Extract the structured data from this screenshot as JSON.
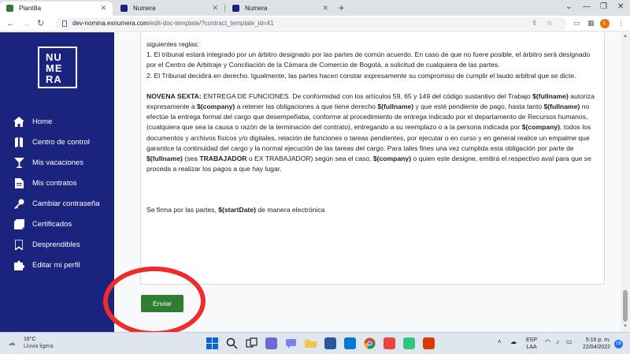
{
  "browser": {
    "tabs": [
      {
        "title": "Plantilla",
        "color": "#2e7d32"
      },
      {
        "title": "Numera",
        "color": "#1a237e"
      },
      {
        "title": "Numera",
        "color": "#1a237e"
      }
    ],
    "new_tab_symbol": "+",
    "url_host": "dev-nomina.esnumera.com",
    "url_path": "/edit-doc-template/?contract_template_id=41",
    "profile_initial": "L"
  },
  "logo": {
    "letters": [
      "NU",
      "ME",
      "RA"
    ]
  },
  "sidebar": {
    "items": [
      {
        "label": "Home",
        "icon": "home-icon"
      },
      {
        "label": "Centro de control",
        "icon": "book-icon"
      },
      {
        "label": "Mis vacaciones",
        "icon": "cocktail-icon"
      },
      {
        "label": "Mis contratos",
        "icon": "document-icon"
      },
      {
        "label": "Cambiar contraseña",
        "icon": "key-icon"
      },
      {
        "label": "Certificados",
        "icon": "certificate-icon"
      },
      {
        "label": "Desprendibles",
        "icon": "bookmark-icon"
      },
      {
        "label": "Editar mi perfil",
        "icon": "puzzle-icon"
      }
    ]
  },
  "document": {
    "p0": "siguientes reglas:",
    "p1": "1. El tribunal estará integrado por un árbitro designado por las partes de común acuerdo. En caso de que no fuere posible, el árbitro será designado por el Centro de Arbitraje y Conciliación de la Cámara de Comercio de Bogotá, a solicitud de cualquiera de las partes.",
    "p2": "2. El Tribunal decidirá en derecho. Igualmente, las partes hacen constar expresamente su compromiso de cumplir el laudo arbitral que se dicte.",
    "clause": {
      "heading": "NOVENA SEXTA:",
      "t1": " ENTREGA DE FUNCIONES",
      "t2": ". De conformidad con los artículos 59, 65 y 149 del código sustantivo del Trabajo ",
      "v_fullname": "$(fullname)",
      "v_company": "$(company)",
      "t3": " autoriza expresamente a ",
      "t4": " a retener las obligaciones a que tiene derecho ",
      "t5": " y que esté pendiente de pago, hasta tanto ",
      "t6": " no efectúe la entrega formal del cargo que desempeñaba, conforme al procedimiento de entrega indicado por el departamento de Recursos humanos, (cualquiera que sea la causa o razón de la terminación del contrato), entregando a su reemplazo o a la persona indicada por ",
      "t7": ",  todos los documentos y archivos físicos y/o digitales, relación de funciones o tareas pendientes,  por ejecutar o en curso y en general realice un empalme que garantice la continuidad del  cargo y la normal ejecución de las tareas del cargo. Para tales fines una vez cumplida esta obligación por parte de ",
      "t8": " (sea ",
      "trabajador": "TRABAJADOR",
      "t9": " o EX TRABAJADOR) según sea el caso,  ",
      "t10": " o quien este designe, emitirá el respectivo aval para que se proceda a realizar los pagos a que hay lugar."
    },
    "sign_text": "Se firma por las partes, ",
    "sign_var": "$(startDate)",
    "sign_tail": " de manera electrónica"
  },
  "actions": {
    "submit_label": "Enviar"
  },
  "colors": {
    "sidebar_bg": "#1a237e",
    "submit_bg": "#2e7d32",
    "annotation": "#ef2b2b"
  },
  "taskbar": {
    "weather_temp": "16°C",
    "weather_condition": "Lluvia ligera",
    "lang_line1": "ESP",
    "lang_line2": "LAA",
    "time": "5:16 p. m.",
    "date": "22/04/2022",
    "notifications": "16"
  }
}
